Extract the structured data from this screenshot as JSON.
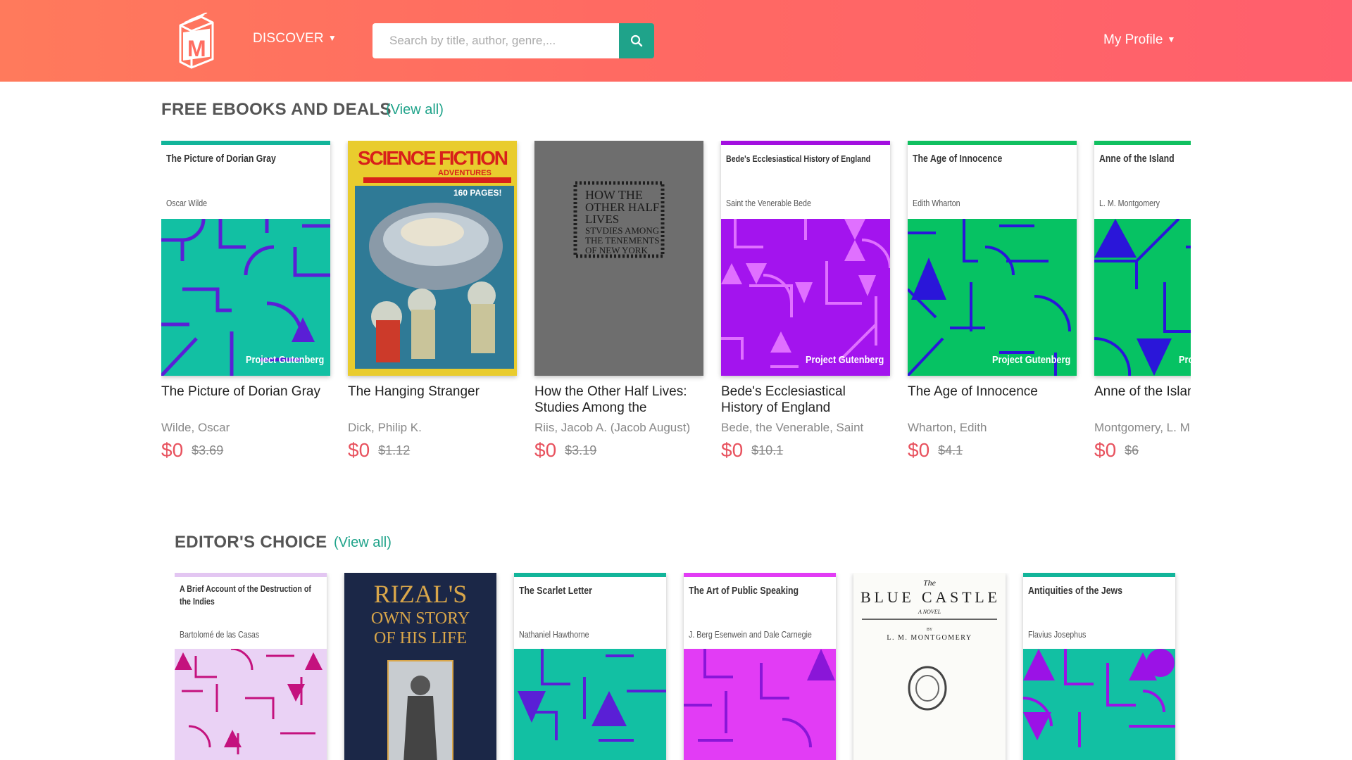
{
  "header": {
    "logo_letter": "M",
    "discover_label": "DISCOVER",
    "search_placeholder": "Search by title, author, genre,...",
    "search_value": "",
    "profile_label": "My Profile"
  },
  "free_section": {
    "title": "FREE EBOOKS AND DEALS",
    "view_all": "(View all)",
    "books": [
      {
        "cover_title": "The Picture of Dorian Gray",
        "cover_author": "Oscar Wilde",
        "cover_badge": "Project Gutenberg",
        "title": "The Picture of Dorian Gray",
        "author": "Wilde, Oscar",
        "price": "$0",
        "old_price": "$3.69",
        "bar_color": "#12b59a",
        "bg_color": "#12c0a3",
        "shape_color": "#5a1fd6"
      },
      {
        "cover_title": "SCIENCE FICTION",
        "cover_subtitle": "ADVENTURES",
        "cover_tagline": "160 PAGES!",
        "title": "The Hanging Stranger",
        "author": "Dick, Philip K.",
        "price": "$0",
        "old_price": "$1.12"
      },
      {
        "cover_lines": [
          "HOW THE",
          "OTHER HALF",
          "LIVES",
          "STVDIES AMONG",
          "THE TENEMENTS",
          "OF NEW YORK"
        ],
        "title": "How the Other Half Lives: Studies Among the Tenements of New York",
        "author": "Riis, Jacob A. (Jacob August)",
        "price": "$0",
        "old_price": "$3.19"
      },
      {
        "cover_title": "Bede's Ecclesiastical History of England",
        "cover_author": "Saint the Venerable Bede",
        "cover_badge": "Project Gutenberg",
        "title": "Bede's Ecclesiastical History of England",
        "author": "Bede, the Venerable, Saint",
        "price": "$0",
        "old_price": "$10.1",
        "bar_color": "#a30fe0",
        "bg_color": "#a314ee",
        "shape_color": "#e070ff"
      },
      {
        "cover_title": "The Age of Innocence",
        "cover_author": "Edith Wharton",
        "cover_badge": "Project Gutenberg",
        "title": "The Age of Innocence",
        "author": "Wharton, Edith",
        "price": "$0",
        "old_price": "$4.1",
        "bar_color": "#10c060",
        "bg_color": "#06c263",
        "shape_color": "#2a16d9"
      },
      {
        "cover_title": "Anne of the Island",
        "cover_author": "L. M. Montgomery",
        "cover_badge": "Project Gutenberg",
        "title": "Anne of the Island",
        "author": "Montgomery, L. M.",
        "price": "$0",
        "old_price": "$6",
        "bar_color": "#10c060",
        "bg_color": "#06c263",
        "shape_color": "#2a16d9"
      }
    ]
  },
  "editors_section": {
    "title": "EDITOR'S CHOICE",
    "view_all": "(View all)",
    "books": [
      {
        "cover_title": "A Brief Account of the Destruction of the Indies",
        "cover_author": "Bartolomé de las Casas",
        "bar_color": "#e3c6f2",
        "bg_color": "#ead2f5",
        "shape_color": "#c4127e"
      },
      {
        "cover_lines": [
          "RIZAL'S",
          "OWN STORY",
          "OF HIS LIFE"
        ]
      },
      {
        "cover_title": "The Scarlet Letter",
        "cover_author": "Nathaniel Hawthorne",
        "bar_color": "#12b59a",
        "bg_color": "#12c0a3",
        "shape_color": "#5a1fd6"
      },
      {
        "cover_title": "The Art of Public Speaking",
        "cover_author": "J. Berg Esenwein and Dale Carnegie",
        "bar_color": "#e23cf5",
        "bg_color": "#e23cf5",
        "shape_color": "#8a16d8"
      },
      {
        "cover_the": "The",
        "cover_title": "BLUE CASTLE",
        "cover_novel": "A NOVEL",
        "cover_by": "BY",
        "cover_author": "L. M. MONTGOMERY"
      },
      {
        "cover_title": "Antiquities of the Jews",
        "cover_author": "Flavius Josephus",
        "bar_color": "#12b59a",
        "bg_color": "#12c0a3",
        "shape_color": "#9b12e6"
      }
    ]
  }
}
